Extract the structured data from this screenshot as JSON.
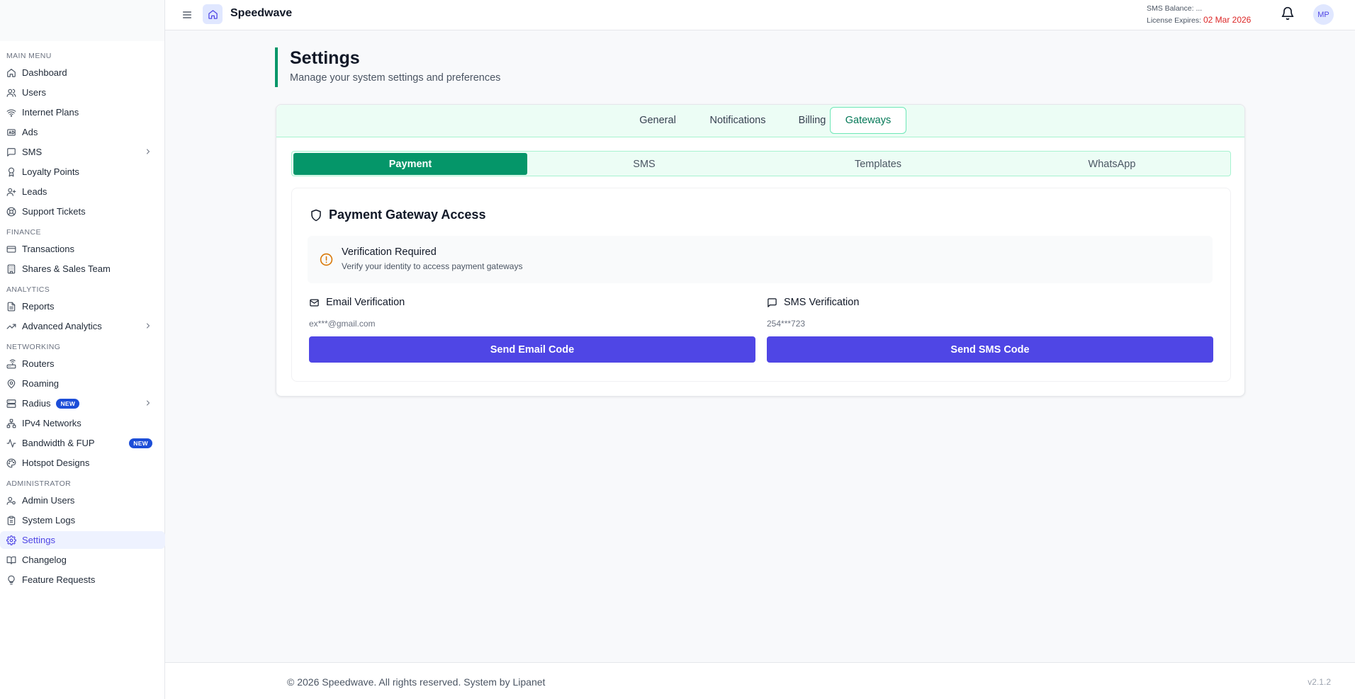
{
  "app": {
    "name": "Speedwave"
  },
  "header": {
    "sms_balance_label": "SMS Balance:",
    "sms_balance_value": "...",
    "license_label": "License Expires:",
    "license_value": "02 Mar 2026",
    "avatar_initials": "MP",
    "icons": [
      "menu-icon",
      "home-icon",
      "bell-icon"
    ]
  },
  "sidebar": {
    "sections": [
      {
        "title": "MAIN MENU",
        "items": [
          {
            "label": "Dashboard",
            "icon": "home-icon"
          },
          {
            "label": "Users",
            "icon": "users-icon"
          },
          {
            "label": "Internet Plans",
            "icon": "wifi-icon"
          },
          {
            "label": "Ads",
            "icon": "ads-icon"
          },
          {
            "label": "SMS",
            "icon": "message-icon",
            "chevron": true
          },
          {
            "label": "Loyalty Points",
            "icon": "award-icon"
          },
          {
            "label": "Leads",
            "icon": "user-plus-icon"
          },
          {
            "label": "Support Tickets",
            "icon": "lifebuoy-icon"
          }
        ]
      },
      {
        "title": "FINANCE",
        "items": [
          {
            "label": "Transactions",
            "icon": "credit-card-icon"
          },
          {
            "label": "Shares & Sales Team",
            "icon": "building-icon"
          }
        ]
      },
      {
        "title": "ANALYTICS",
        "items": [
          {
            "label": "Reports",
            "icon": "file-text-icon"
          },
          {
            "label": "Advanced Analytics",
            "icon": "trending-up-icon",
            "chevron": true
          }
        ]
      },
      {
        "title": "NETWORKING",
        "items": [
          {
            "label": "Routers",
            "icon": "router-icon"
          },
          {
            "label": "Roaming",
            "icon": "map-pin-icon"
          },
          {
            "label": "Radius",
            "icon": "server-icon",
            "badge": "NEW",
            "chevron": true
          },
          {
            "label": "IPv4 Networks",
            "icon": "network-icon"
          },
          {
            "label": "Bandwidth & FUP",
            "icon": "activity-icon",
            "badge": "NEW"
          },
          {
            "label": "Hotspot Designs",
            "icon": "palette-icon"
          }
        ]
      },
      {
        "title": "ADMINISTRATOR",
        "items": [
          {
            "label": "Admin Users",
            "icon": "user-cog-icon"
          },
          {
            "label": "System Logs",
            "icon": "clipboard-icon"
          },
          {
            "label": "Settings",
            "icon": "gear-icon",
            "active": true
          },
          {
            "label": "Changelog",
            "icon": "book-icon"
          },
          {
            "label": "Feature Requests",
            "icon": "lightbulb-icon"
          }
        ]
      }
    ]
  },
  "page": {
    "title": "Settings",
    "subtitle": "Manage your system settings and preferences"
  },
  "tabs": [
    {
      "label": "General"
    },
    {
      "label": "Notifications"
    },
    {
      "label": "Billing"
    },
    {
      "label": "Gateways",
      "active": true
    }
  ],
  "subtabs": [
    {
      "label": "Payment",
      "active": true
    },
    {
      "label": "SMS"
    },
    {
      "label": "Templates"
    },
    {
      "label": "WhatsApp"
    }
  ],
  "gateway": {
    "title": "Payment Gateway Access",
    "alert_title": "Verification Required",
    "alert_text": "Verify your identity to access payment gateways",
    "email": {
      "label": "Email Verification",
      "value": "ex***@gmail.com",
      "button": "Send Email Code"
    },
    "sms": {
      "label": "SMS Verification",
      "value": "254***723",
      "button": "Send SMS Code"
    }
  },
  "footer": {
    "copyright": "© 2026 Speedwave. All rights reserved. System by Lipanet",
    "version": "v2.1.2"
  },
  "colors": {
    "primary": "#4f46e5",
    "accent_green": "#059669",
    "license_red": "#dc2626",
    "badge_blue": "#1d4ed8"
  }
}
